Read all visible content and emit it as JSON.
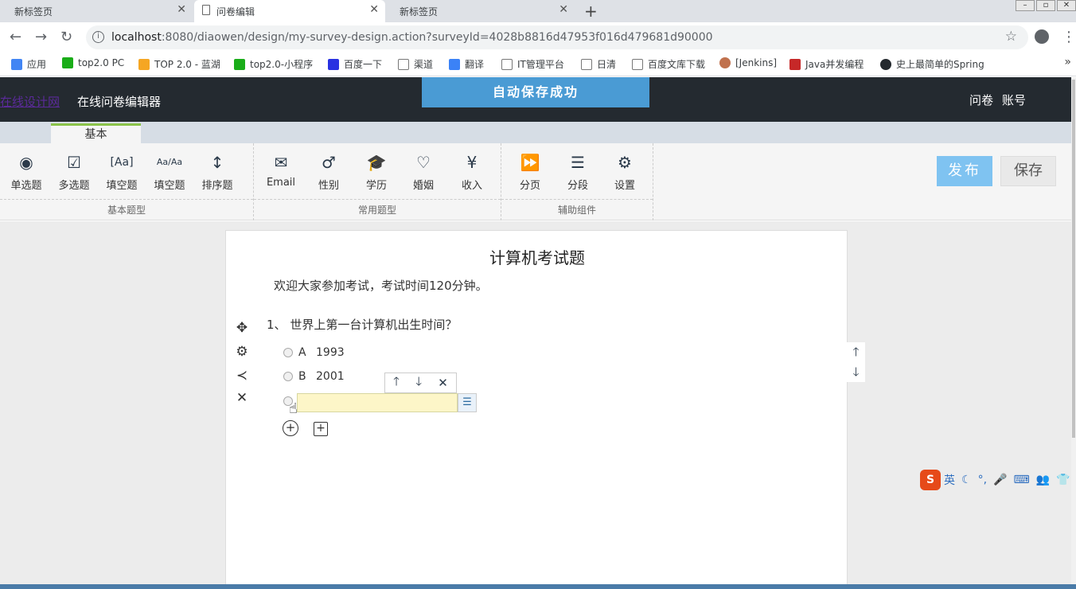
{
  "browser": {
    "tabs": [
      {
        "label": "新标签页",
        "active": false
      },
      {
        "label": "问卷编辑",
        "active": true
      },
      {
        "label": "新标签页",
        "active": false
      }
    ],
    "url_host": "localhost",
    "url_path": ":8080/diaowen/design/my-survey-design.action?surveyId=4028b8816d47953f016d479681d90000",
    "bookmarks": [
      {
        "label": "应用",
        "color": "#4285f4"
      },
      {
        "label": "top2.0 PC",
        "color": "#1aad19"
      },
      {
        "label": "TOP 2.0 - 蓝湖",
        "color": "#f5a623"
      },
      {
        "label": "top2.0-小程序",
        "color": "#1aad19"
      },
      {
        "label": "百度一下",
        "color": "#2932e1"
      },
      {
        "label": "渠道",
        "color": "#9e9e9e"
      },
      {
        "label": "翻译",
        "color": "#3b82f6"
      },
      {
        "label": "IT管理平台",
        "color": "#9e9e9e"
      },
      {
        "label": "日清",
        "color": "#9e9e9e"
      },
      {
        "label": "百度文库下载",
        "color": "#9e9e9e"
      },
      {
        "label": "[Jenkins]",
        "color": "#c0714d"
      },
      {
        "label": "Java并发编程",
        "color": "#c62828"
      },
      {
        "label": "史上最简单的Spring",
        "color": "#24292e"
      }
    ]
  },
  "header": {
    "logo_text": "在线设计网",
    "app_title": "在线问卷编辑器",
    "autosave_text": "自动保存成功",
    "menu": [
      "问卷",
      "账号"
    ]
  },
  "toolbar": {
    "tab_label": "基本",
    "groups": [
      {
        "label": "基本题型",
        "items": [
          {
            "label": "单选题",
            "icon": "radio-icon"
          },
          {
            "label": "多选题",
            "icon": "checkbox-icon"
          },
          {
            "label": "填空题",
            "icon": "text-input-icon"
          },
          {
            "label": "填空题",
            "icon": "multi-text-input-icon"
          },
          {
            "label": "排序题",
            "icon": "sort-icon"
          }
        ]
      },
      {
        "label": "常用题型",
        "items": [
          {
            "label": "Email",
            "icon": "email-icon"
          },
          {
            "label": "性别",
            "icon": "gender-icon"
          },
          {
            "label": "学历",
            "icon": "graduation-cap-icon"
          },
          {
            "label": "婚姻",
            "icon": "heart-icon"
          },
          {
            "label": "收入",
            "icon": "yen-icon"
          }
        ]
      },
      {
        "label": "辅助组件",
        "items": [
          {
            "label": "分页",
            "icon": "page-break-icon"
          },
          {
            "label": "分段",
            "icon": "paragraph-icon"
          },
          {
            "label": "设置",
            "icon": "settings-doc-icon"
          }
        ]
      }
    ],
    "publish_label": "发布",
    "save_label": "保存"
  },
  "survey": {
    "title": "计算机考试题",
    "description": "欢迎大家参加考试，考试时间120分钟。",
    "question": {
      "number": "1、",
      "text": "世界上第一台计算机出生时间？",
      "options": [
        {
          "letter": "A",
          "text": "1993"
        },
        {
          "letter": "B",
          "text": "2001"
        }
      ],
      "editing_option_value": ""
    }
  },
  "ime": {
    "lang": "英"
  }
}
